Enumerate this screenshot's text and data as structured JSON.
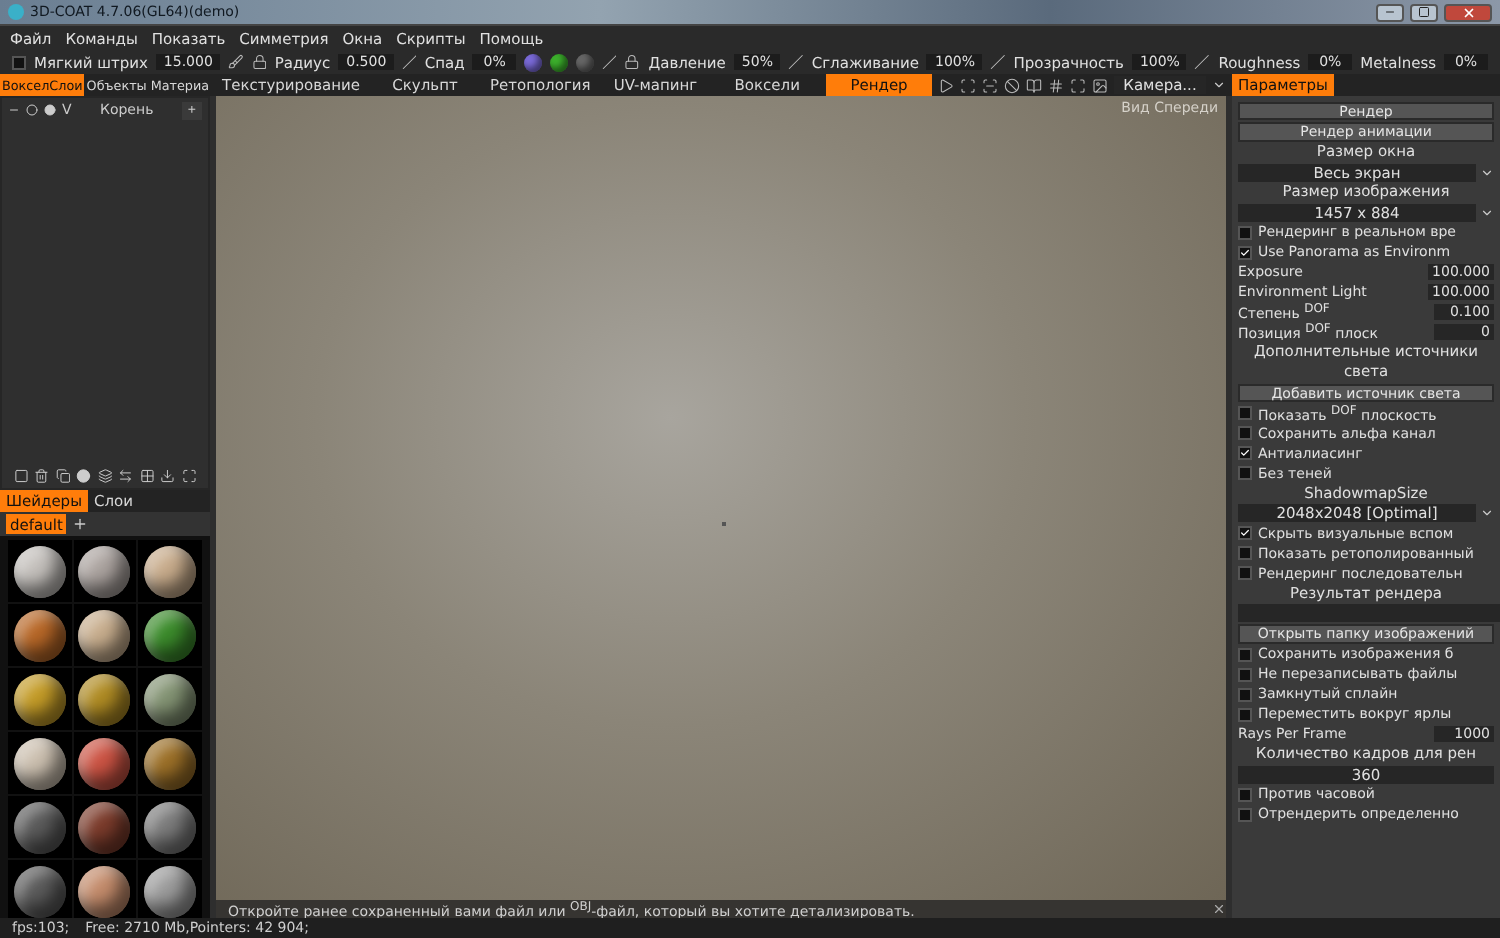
{
  "window": {
    "title": "3D-COAT 4.7.06(GL64)(demo)"
  },
  "menu": [
    "Файл",
    "Команды",
    "Показать",
    "Симметрия",
    "Окна",
    "Скрипты",
    "Помощь"
  ],
  "toolbar": {
    "soft_stroke": {
      "label": "Мягкий штрих",
      "checked": false,
      "value": "15.000"
    },
    "params": [
      {
        "label": "Радиус",
        "value": "0.500"
      },
      {
        "label": "Спад",
        "value": "0%"
      },
      {
        "label": "Давление",
        "value": "50%"
      },
      {
        "label": "Сглаживание",
        "value": "100%"
      },
      {
        "label": "Прозрачность",
        "value": "100%"
      },
      {
        "label": "Roughness",
        "value": "0%"
      },
      {
        "label": "Metalness",
        "value": "0%"
      }
    ]
  },
  "left_tabs": [
    {
      "label": "ВокселСлои",
      "selected": true
    },
    {
      "label": "Объекты",
      "selected": false
    },
    {
      "label": "Материа",
      "selected": false
    }
  ],
  "room_tabs": [
    {
      "label": "Текстурирование",
      "selected": false
    },
    {
      "label": "Скульпт",
      "selected": false
    },
    {
      "label": "Ретопология",
      "selected": false
    },
    {
      "label": "UV-мапинг",
      "selected": false
    },
    {
      "label": "Воксели",
      "selected": false
    },
    {
      "label": "Рендер",
      "selected": true
    }
  ],
  "camera_dropdown": "Камера...",
  "right_tabs": [
    {
      "label": "Параметры",
      "selected": true
    }
  ],
  "layer_tree": {
    "root": {
      "v": "V",
      "name": "Корень",
      "add": "+"
    }
  },
  "shader_tabs": [
    {
      "label": "Шейдеры",
      "selected": true
    },
    {
      "label": "Слои",
      "selected": false
    }
  ],
  "shader_folder": {
    "label": "default",
    "selected": true
  },
  "shaders": [
    {
      "color": "#c4c0bc"
    },
    {
      "color": "#aca4a0"
    },
    {
      "color": "#c8ac8c"
    },
    {
      "color": "#b86828"
    },
    {
      "color": "#c8ae8e"
    },
    {
      "color": "#3c8c2c"
    },
    {
      "color": "#c49c28"
    },
    {
      "color": "#b08c24"
    },
    {
      "color": "#849474"
    },
    {
      "color": "#ccc0b0"
    },
    {
      "color": "#cc5444"
    },
    {
      "color": "#9c7028"
    },
    {
      "color": "#5c5c5c"
    },
    {
      "color": "#7c3c2c"
    },
    {
      "color": "#7c7c7c"
    },
    {
      "color": "#5c5c5c"
    },
    {
      "color": "#c48c6c"
    },
    {
      "color": "#9c9c9c"
    }
  ],
  "viewport": {
    "view_label": "Вид Спереди",
    "hint": "Откройте ранее сохраненный вами файл или $^{OBJ}$-файл, который вы хотите детализировать."
  },
  "params_panel": [
    {
      "kind": "button",
      "label": "Рендер"
    },
    {
      "kind": "button",
      "label": "Рендер анимации"
    },
    {
      "kind": "label",
      "label": "Размер окна"
    },
    {
      "kind": "dropdown",
      "value": "Весь экран"
    },
    {
      "kind": "label",
      "label": "Размер изображения"
    },
    {
      "kind": "dropdown",
      "value": "1457 x 884"
    },
    {
      "kind": "checkbox",
      "label": "Рендеринг в реальном вре",
      "checked": false
    },
    {
      "kind": "checkbox",
      "label": "Use Panorama as Environm",
      "checked": true
    },
    {
      "kind": "number",
      "label": "Exposure",
      "value": "100.000"
    },
    {
      "kind": "number",
      "label": "Environment Light",
      "value": "100.000"
    },
    {
      "kind": "number",
      "label": "Степень $^{DOF}$",
      "value": "0.100"
    },
    {
      "kind": "number",
      "label": "Позиция $^{DOF}$ плоск",
      "value": "0"
    },
    {
      "kind": "label",
      "label": "Дополнительные источники света"
    },
    {
      "kind": "button",
      "label": "Добавить источник света"
    },
    {
      "kind": "checkbox",
      "label": "Показать $^{DOF}$ плоскость",
      "checked": false
    },
    {
      "kind": "checkbox",
      "label": "Сохранить альфа канал",
      "checked": false
    },
    {
      "kind": "checkbox",
      "label": "Антиалиасинг",
      "checked": true
    },
    {
      "kind": "checkbox",
      "label": "Без теней",
      "checked": false
    },
    {
      "kind": "label",
      "label": "ShadowmapSize"
    },
    {
      "kind": "dropdown",
      "value": "2048x2048 [Optimal]"
    },
    {
      "kind": "checkbox",
      "label": "Скрыть визуальные вспом",
      "checked": true
    },
    {
      "kind": "checkbox",
      "label": "Показать ретополированный",
      "checked": false
    },
    {
      "kind": "checkbox",
      "label": "Рендеринг последовательн",
      "checked": false
    },
    {
      "kind": "label",
      "label": "Результат рендера"
    },
    {
      "kind": "field"
    },
    {
      "kind": "button",
      "label": "Открыть папку изображений"
    },
    {
      "kind": "checkbox",
      "label": "Сохранить изображения б",
      "checked": false
    },
    {
      "kind": "checkbox",
      "label": "Не перезаписывать файлы",
      "checked": false
    },
    {
      "kind": "checkbox",
      "label": "Замкнутый сплайн",
      "checked": false
    },
    {
      "kind": "checkbox",
      "label": "Переместить вокруг ярлы",
      "checked": false
    },
    {
      "kind": "number",
      "label": "Rays Per Frame",
      "value": "1000"
    },
    {
      "kind": "label",
      "label": "Количество кадров для рен"
    },
    {
      "kind": "bar",
      "value": "360"
    },
    {
      "kind": "checkbox",
      "label": "Против часовой",
      "checked": false
    },
    {
      "kind": "checkbox",
      "label": "Отрендерить определенно",
      "checked": false
    }
  ],
  "status_bar": {
    "fps": "fps:103;",
    "memory": "Free: 2710 Mb,Pointers: 42 904;"
  }
}
